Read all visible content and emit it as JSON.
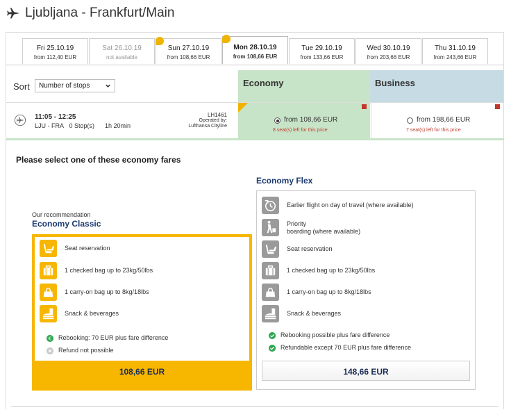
{
  "header": {
    "title": "Ljubljana - Frankfurt/Main"
  },
  "dates": [
    {
      "day": "Fri 25.10.19",
      "price": "from 112,40 EUR",
      "state": "normal"
    },
    {
      "day": "Sat 26.10.19",
      "price": "not available",
      "state": "unavailable"
    },
    {
      "day": "Sun 27.10.19",
      "price": "from 108,66 EUR",
      "state": "lowprice"
    },
    {
      "day": "Mon 28.10.19",
      "price": "from 108,66 EUR",
      "state": "selected"
    },
    {
      "day": "Tue 29.10.19",
      "price": "from 133,66 EUR",
      "state": "normal"
    },
    {
      "day": "Wed 30.10.19",
      "price": "from 203,66 EUR",
      "state": "normal"
    },
    {
      "day": "Thu 31.10.19",
      "price": "from 243,66 EUR",
      "state": "normal"
    }
  ],
  "sort": {
    "label": "Sort",
    "selected": "Number of stops"
  },
  "cabins": {
    "economy": "Economy",
    "business": "Business"
  },
  "flight": {
    "time": "11:05 - 12:25",
    "route": "LJU - FRA",
    "stops": "0 Stop(s)",
    "duration": "1h 20min",
    "number": "LH1461",
    "operated_by": "Operated by:",
    "operator": "Lufthansa Cityline",
    "economy_price": "from 108,66 EUR",
    "economy_seats": "8 seat(s) left for this price",
    "business_price": "from 198,66 EUR",
    "business_seats": "7 seat(s) left for this price"
  },
  "panel": {
    "title": "Please select one of these economy fares",
    "recommendation": "Our recommendation"
  },
  "classic": {
    "name": "Economy Classic",
    "features": [
      {
        "icon": "seat-icon",
        "text": "Seat reservation"
      },
      {
        "icon": "checked-bag-icon",
        "text": "1 checked bag up to 23kg/50lbs"
      },
      {
        "icon": "carry-on-bag-icon",
        "text": "1 carry-on bag up to 8kg/18lbs"
      },
      {
        "icon": "snack-icon",
        "text": "Snack & beverages"
      }
    ],
    "conditions": [
      {
        "icon": "euro-icon",
        "text": "Rebooking: 70 EUR plus fare difference"
      },
      {
        "icon": "cross-icon",
        "text": "Refund not possible"
      }
    ],
    "price": "108,66 EUR"
  },
  "flex": {
    "name": "Economy Flex",
    "features": [
      {
        "icon": "earlier-flight-icon",
        "text": "Earlier flight on day of travel (where available)"
      },
      {
        "icon": "priority-boarding-icon",
        "text": "Priority",
        "text2": "boarding (where available)"
      },
      {
        "icon": "seat-icon",
        "text": "Seat reservation"
      },
      {
        "icon": "checked-bag-icon",
        "text": "1 checked bag up to 23kg/50lbs"
      },
      {
        "icon": "carry-on-bag-icon",
        "text": "1 carry-on bag up to 8kg/18lbs"
      },
      {
        "icon": "snack-icon",
        "text": "Snack & beverages"
      }
    ],
    "conditions": [
      {
        "icon": "check-icon",
        "text": "Rebooking possible plus fare difference"
      },
      {
        "icon": "check-icon",
        "text": "Refundable except 70 EUR plus fare difference"
      }
    ],
    "price": "148,66 EUR"
  },
  "colors": {
    "yellow": "#f7b600",
    "economy_green": "#c8e4c8",
    "business_blue": "#c6dbe3",
    "navy": "#1c3a70",
    "seat_red": "#c0392b"
  }
}
